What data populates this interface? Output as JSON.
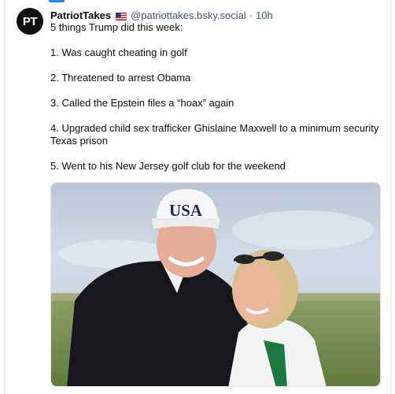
{
  "post": {
    "avatar_initials": "PT",
    "display_name": "PatriotTakes",
    "flag_icon": "us-flag-icon",
    "handle": "@patriottakes.bsky.social",
    "separator": "·",
    "timestamp": "10h",
    "lines": [
      "5 things Trump did this week:",
      "1. Was caught cheating in golf",
      "2. Threatened to arrest Obama",
      "3. Called the Epstein files a “hoax” again",
      "4. Upgraded child sex trafficker Ghislaine Maxwell to a minimum security Texas prison",
      "5. Went to his New Jersey golf club for the weekend"
    ],
    "image": {
      "hat_text": "USA"
    }
  },
  "colors": {
    "accent": "#1d8cf0",
    "muted_text": "#42576c",
    "text": "#0b0f14"
  }
}
